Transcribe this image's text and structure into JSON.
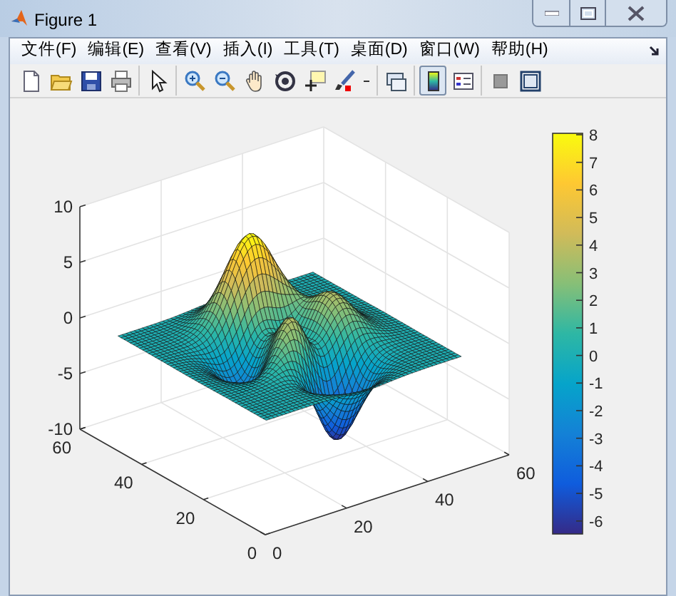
{
  "window": {
    "title": "Figure 1"
  },
  "menu": [
    "文件(F)",
    "编辑(E)",
    "查看(V)",
    "插入(I)",
    "工具(T)",
    "桌面(D)",
    "窗口(W)",
    "帮助(H)"
  ],
  "toolbar_groups": [
    [
      {
        "kind": "new",
        "on": false
      },
      {
        "kind": "open",
        "on": false
      },
      {
        "kind": "save",
        "on": false
      },
      {
        "kind": "print",
        "on": false
      }
    ],
    [
      {
        "kind": "pointer",
        "on": false
      }
    ],
    [
      {
        "kind": "zoom-in",
        "on": false
      },
      {
        "kind": "zoom-out",
        "on": false
      },
      {
        "kind": "pan",
        "on": false
      },
      {
        "kind": "rotate",
        "on": false
      },
      {
        "kind": "data-cursor",
        "on": false
      },
      {
        "kind": "brush",
        "on": false
      },
      {
        "kind": "dropdown",
        "on": false
      }
    ],
    [
      {
        "kind": "link",
        "on": false
      }
    ],
    [
      {
        "kind": "colorbar",
        "on": true
      },
      {
        "kind": "legend",
        "on": false
      }
    ],
    [
      {
        "kind": "hide-tools",
        "on": false
      },
      {
        "kind": "show-tools",
        "on": false
      }
    ]
  ],
  "axes": {
    "z_ticks": [
      "10",
      "5",
      "0",
      "-5",
      "-10"
    ],
    "y_ticks": [
      "60",
      "40",
      "20",
      "0"
    ],
    "x_ticks": [
      "0",
      "20",
      "40",
      "60"
    ]
  },
  "colorbar": {
    "ticks": [
      "8",
      "7",
      "6",
      "5",
      "4",
      "3",
      "2",
      "1",
      "0",
      "-1",
      "-2",
      "-3",
      "-4",
      "-5",
      "-6"
    ]
  }
}
